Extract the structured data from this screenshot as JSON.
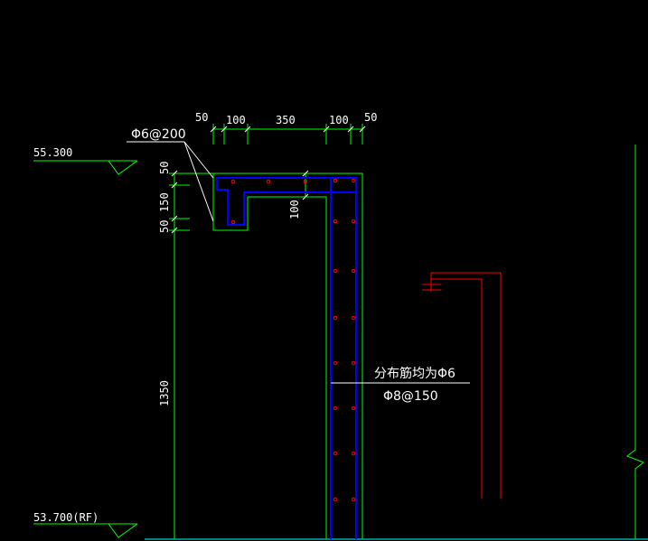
{
  "drawing": {
    "colors": {
      "background": "#000000",
      "dimension_line": "#00ff00",
      "concrete_outline": "#00ff00",
      "rebar": "#0000ff",
      "rebar_dot": "#ff0000",
      "annotation": "#ffffff",
      "section_marker": "#ff0000",
      "ground_line": "#00ffff"
    },
    "top_dims": [
      "50",
      "100",
      "350",
      "100",
      "50"
    ],
    "left_dims": [
      "50",
      "150",
      "50",
      "1350"
    ],
    "inner_dim": "100",
    "rebar_callout_top": "Φ6@200",
    "rebar_callout_wall_1": "分布筋均为Φ6",
    "rebar_callout_wall_2": "Φ8@150",
    "levels": [
      {
        "label": "55.300"
      },
      {
        "label": "53.700(RF)"
      }
    ]
  }
}
